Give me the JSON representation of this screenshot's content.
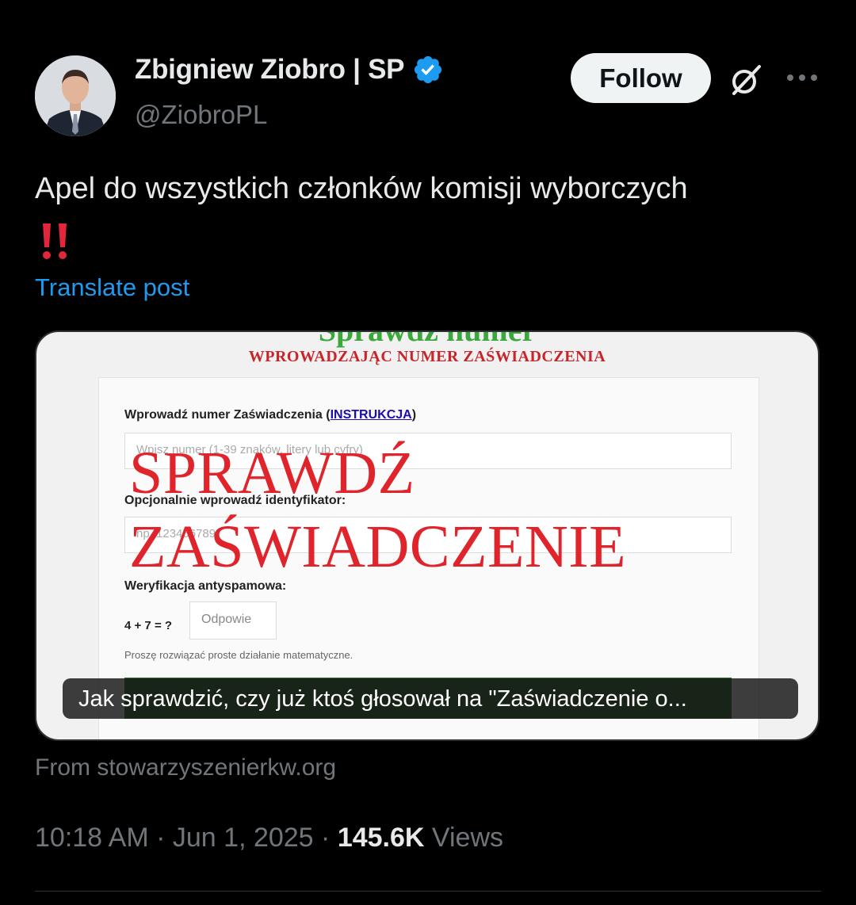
{
  "author": {
    "display_name": "Zbigniew Ziobro | SP",
    "handle": "@ZiobroPL",
    "verified": true,
    "avatar_icon": "profile-photo"
  },
  "actions": {
    "follow_label": "Follow",
    "grok_icon": "grok-icon",
    "more_icon": "more-icon"
  },
  "post": {
    "text": "Apel do wszystkich członków komisji wyborczych",
    "emoji": "double-exclamation-icon",
    "translate_label": "Translate post"
  },
  "card": {
    "heading_partial": "Sprawdź numer",
    "subheading": "WPROWADZAJĄC NUMER ZAŚWIADCZENIA",
    "label_number": "Wprowadź numer Zaświadczenia (",
    "label_number_link": "INSTRUKCJA",
    "label_number_end": ")",
    "placeholder_number": "Wpisz numer (1-39 znaków, litery lub cyfry)",
    "label_identifier": "Opcjonalnie wprowadź identyfikator:",
    "placeholder_identifier": "np. 123456789",
    "label_captcha": "Weryfikacja antyspamowa:",
    "captcha_question": "4 + 7 = ?",
    "captcha_placeholder": "Odpowie",
    "captcha_hint": "Proszę rozwiązać proste działanie matematyczne.",
    "overlay_line1": "SPRAWDŹ",
    "overlay_line2": "ZAŚWIADCZENIE",
    "caption": "Jak sprawdzić, czy już ktoś głosował na \"Zaświadczenie o..."
  },
  "source": "From stowarzyszenierkw.org",
  "meta": {
    "time": "10:18 AM",
    "separator": "·",
    "date": "Jun 1, 2025",
    "views_count": "145.6K",
    "views_label": "Views"
  },
  "colors": {
    "background": "#000000",
    "link_blue": "#1d9bf0",
    "verified_blue": "#1d9bf0",
    "muted": "#71767b",
    "overlay_red": "#e0242c"
  }
}
